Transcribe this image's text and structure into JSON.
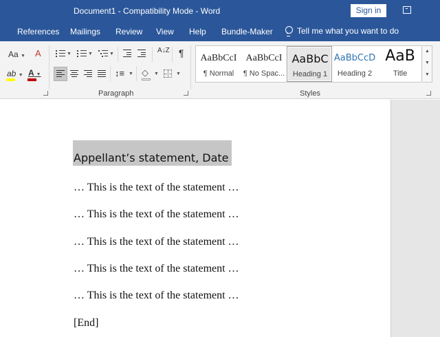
{
  "titlebar": {
    "title": "Document1  -  Compatibility Mode  -  Word",
    "signin": "Sign in"
  },
  "tabs": [
    "References",
    "Mailings",
    "Review",
    "View",
    "Help",
    "Bundle-Maker"
  ],
  "tellme": "Tell me what you want to do",
  "ribbon": {
    "font_case_label": "Aa",
    "highlight_letter": "ab",
    "font_color_letter": "A",
    "sort_glyph": "A↓Z",
    "pilcrow": "¶",
    "paragraph_label": "Paragraph",
    "styles_label": "Styles",
    "highlight_color": "#ffff00",
    "font_color": "#c00000"
  },
  "styles": [
    {
      "preview": "AaBbCcI",
      "label": "¶ Normal"
    },
    {
      "preview": "AaBbCcI",
      "label": "¶ No Spac..."
    },
    {
      "preview": "AaBbC",
      "label": "Heading 1"
    },
    {
      "preview": "AaBbCcD",
      "label": "Heading 2"
    },
    {
      "preview": "AaB",
      "label": "Title"
    }
  ],
  "document": {
    "heading": "Appellant’s statement, Date",
    "paragraphs": [
      "… This is the text of the statement …",
      "… This is the text of the statement …",
      "… This is the text of the statement …",
      "… This is the text of the statement …",
      "… This is the text of the statement …"
    ],
    "end": "[End]"
  }
}
